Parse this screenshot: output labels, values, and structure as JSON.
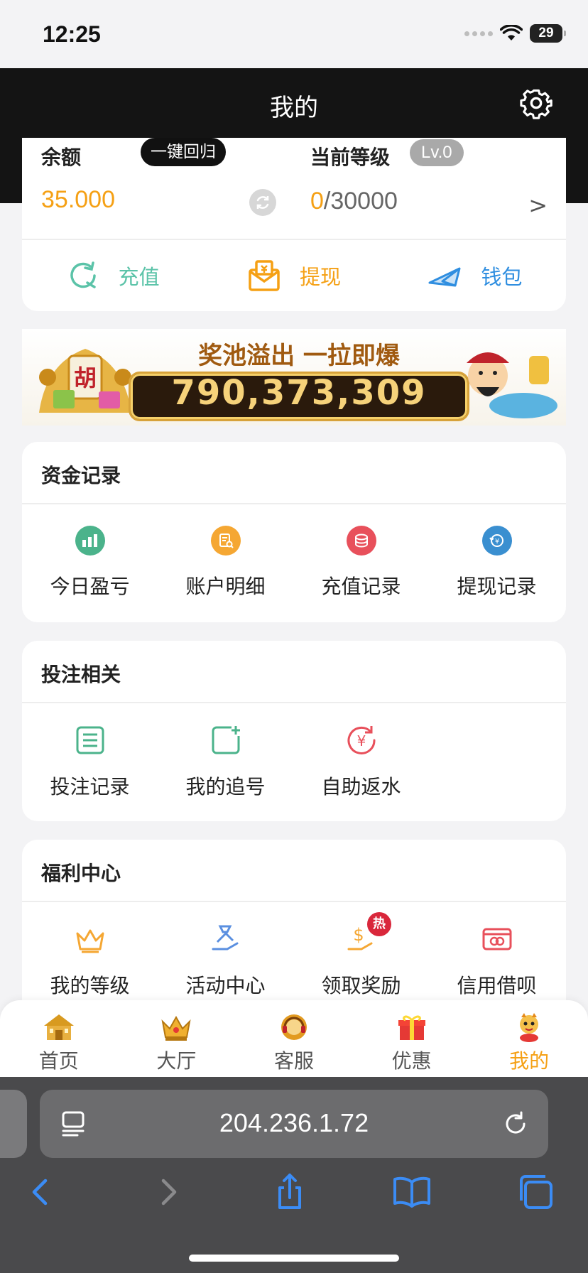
{
  "status_bar": {
    "time": "12:25",
    "battery": "29"
  },
  "header": {
    "title": "我的"
  },
  "balance": {
    "label": "余额",
    "back_button": "一键回归",
    "value": "35.000",
    "level_label": "当前等级",
    "level_badge": "Lv.0",
    "level_current": "0",
    "level_total": "/30000",
    "level_arrow": ">"
  },
  "actions": [
    {
      "label": "充值",
      "icon": "recharge-icon",
      "color": "#5bc3a8"
    },
    {
      "label": "提现",
      "icon": "withdraw-envelope-icon",
      "color": "#f5a014"
    },
    {
      "label": "钱包",
      "icon": "paper-plane-wallet-icon",
      "color": "#2f8ee0"
    }
  ],
  "banner": {
    "slogan": "奖池溢出 一拉即爆",
    "jackpot": "790,373,309"
  },
  "funds_section": {
    "title": "资金记录",
    "items": [
      {
        "label": "今日盈亏",
        "icon": "bar-chart-icon",
        "color": "#4bb38b"
      },
      {
        "label": "账户明细",
        "icon": "document-search-icon",
        "color": "#f5a733"
      },
      {
        "label": "充值记录",
        "icon": "coins-icon",
        "color": "#e8505b"
      },
      {
        "label": "提现记录",
        "icon": "yuan-exchange-icon",
        "color": "#3a8fd0"
      }
    ]
  },
  "bet_section": {
    "title": "投注相关",
    "items": [
      {
        "label": "投注记录",
        "icon": "list-icon",
        "color": "#4bb38b"
      },
      {
        "label": "我的追号",
        "icon": "add-square-icon",
        "color": "#4bb38b"
      },
      {
        "label": "自助返水",
        "icon": "yuan-return-icon",
        "color": "#e8505b"
      }
    ]
  },
  "welfare_section": {
    "title": "福利中心",
    "items": [
      {
        "label": "我的等级",
        "icon": "crown-icon",
        "color": "#f5a733"
      },
      {
        "label": "活动中心",
        "icon": "gift-hand-icon",
        "color": "#5a8fe0"
      },
      {
        "label": "领取奖励",
        "icon": "dollar-hand-icon",
        "color": "#f5a733",
        "badge": "热"
      },
      {
        "label": "信用借呗",
        "icon": "credit-card-icon",
        "color": "#e8505b"
      }
    ]
  },
  "tabbar": [
    {
      "label": "首页",
      "icon": "home-palace-icon"
    },
    {
      "label": "大厅",
      "icon": "crown-hall-icon"
    },
    {
      "label": "客服",
      "icon": "headset-service-icon"
    },
    {
      "label": "优惠",
      "icon": "gift-box-icon"
    },
    {
      "label": "我的",
      "icon": "mascot-profile-icon",
      "active": true
    }
  ],
  "browser": {
    "url": "204.236.1.72"
  }
}
